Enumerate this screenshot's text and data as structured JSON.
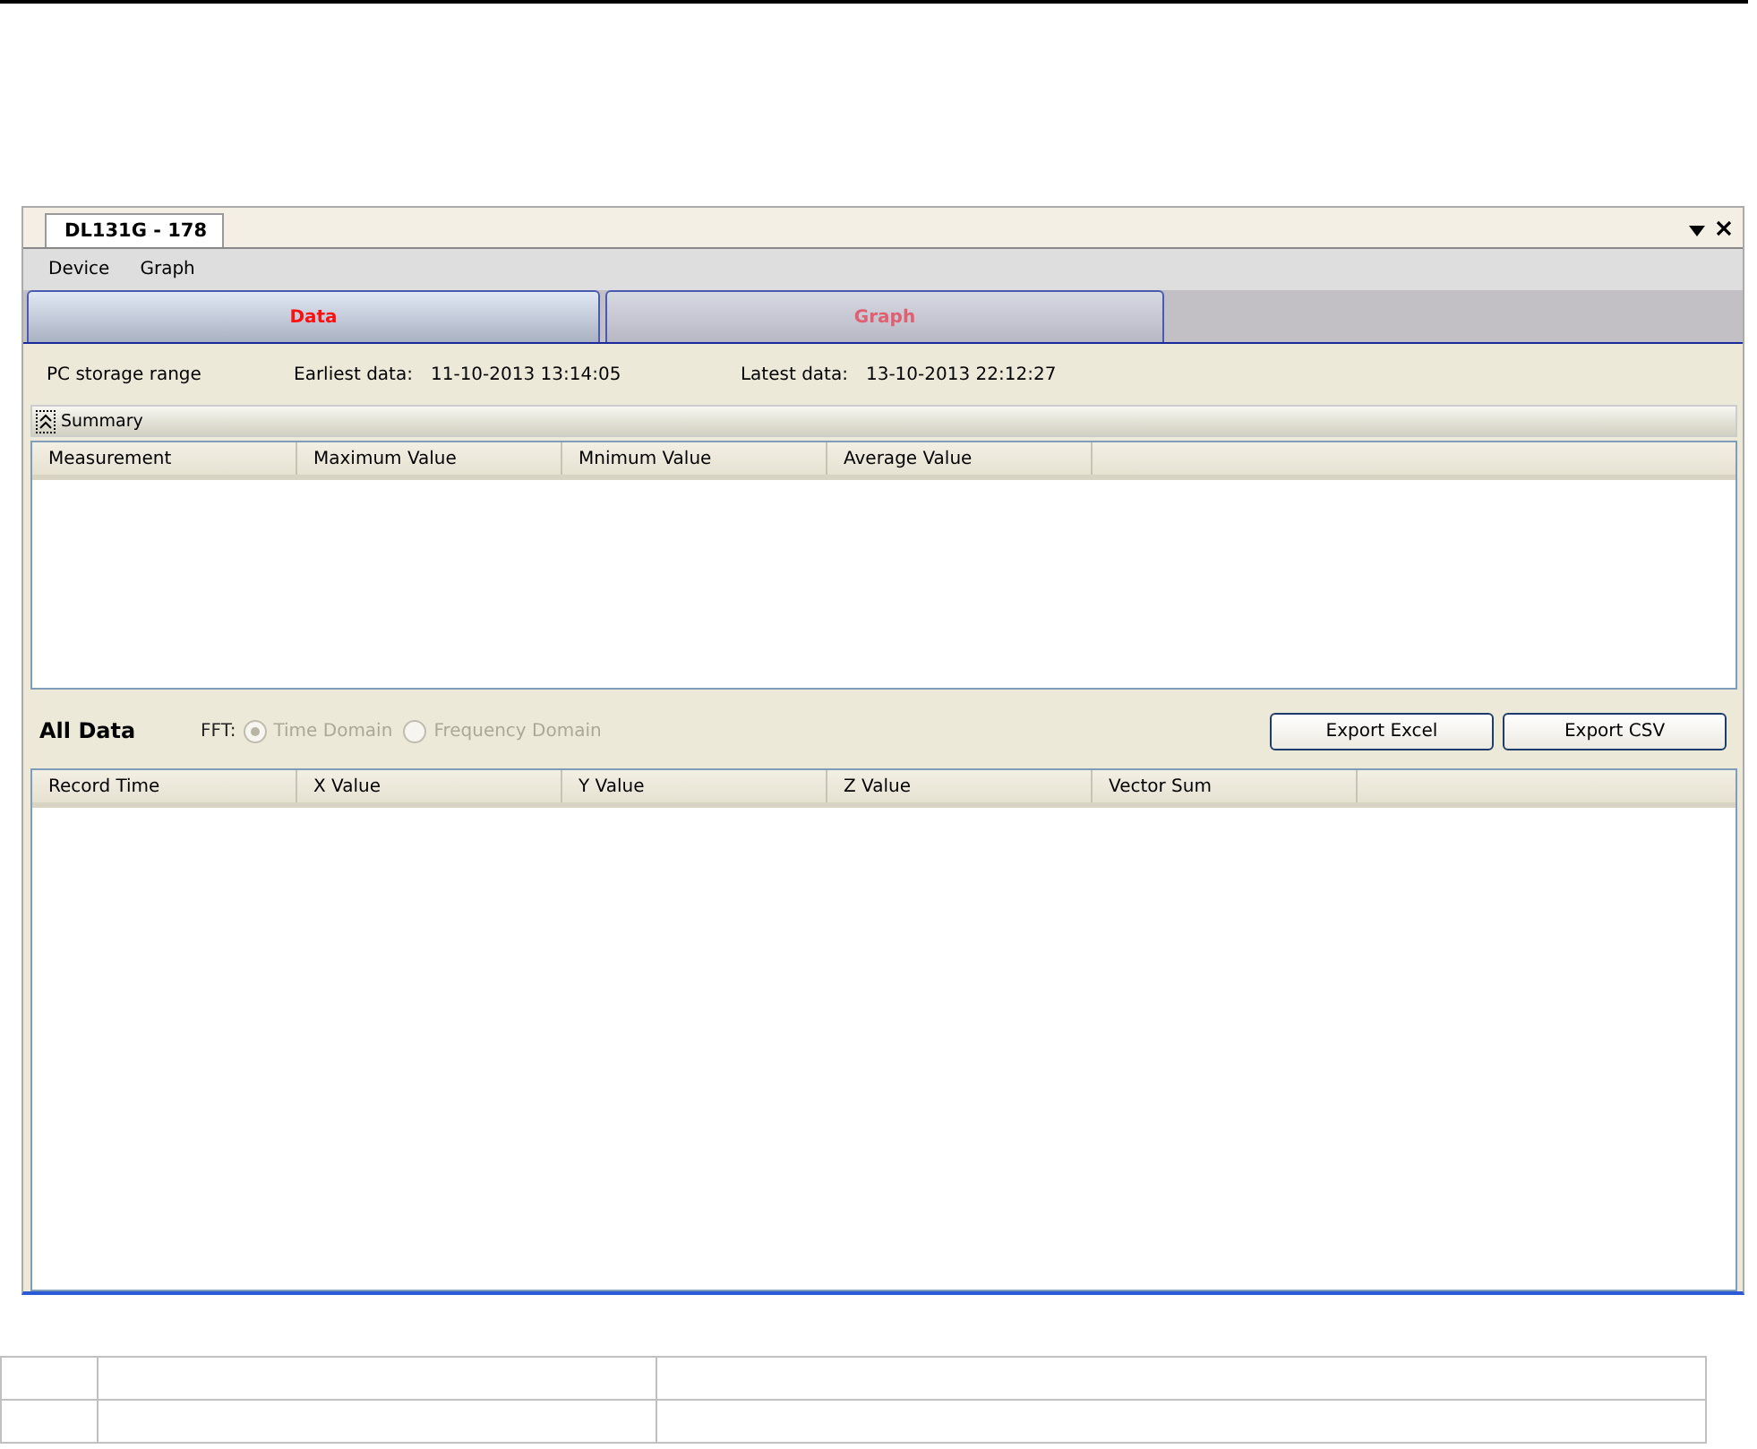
{
  "document_tab": {
    "title": "DL131G - 178"
  },
  "menu": [
    "Device",
    "Graph"
  ],
  "tabs": [
    {
      "label": "Data",
      "selected": true
    },
    {
      "label": "Graph",
      "selected": false
    }
  ],
  "storage": {
    "label": "PC storage range",
    "earliest_label": "Earliest data:",
    "earliest_value": "11-10-2013 13:14:05",
    "latest_label": "Latest data:",
    "latest_value": "13-10-2013 22:12:27"
  },
  "summary": {
    "title": "Summary",
    "expanded": true,
    "columns": [
      "Measurement",
      "Maximum Value",
      "Mnimum Value",
      "Average Value"
    ]
  },
  "all_data": {
    "title": "All Data",
    "fft_label": "FFT:",
    "radios": [
      {
        "label": "Time Domain",
        "selected": true,
        "disabled": true
      },
      {
        "label": "Frequency Domain",
        "selected": false,
        "disabled": true
      }
    ],
    "buttons": [
      "Export Excel",
      "Export CSV"
    ],
    "columns": [
      "Record Time",
      "X Value",
      "Y Value",
      "Z Value",
      "Vector Sum"
    ]
  }
}
